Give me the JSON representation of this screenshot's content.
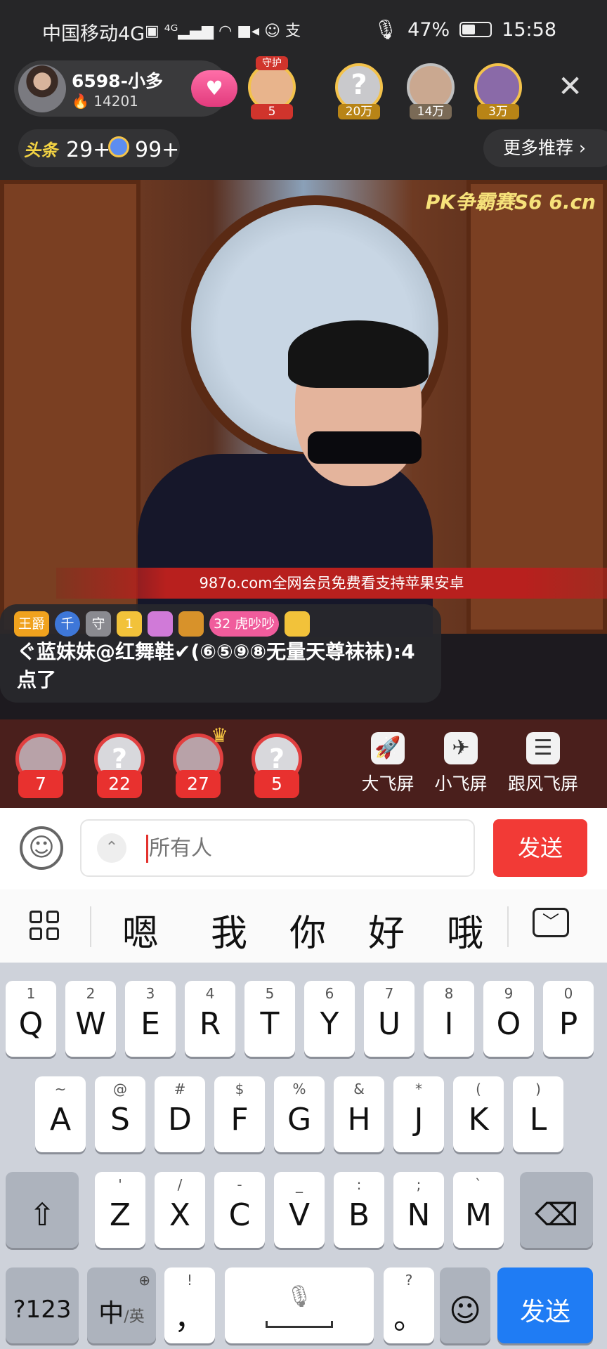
{
  "status_bar": {
    "carrier": "中国移动4G",
    "battery": "47%",
    "time": "15:58",
    "icons": [
      "hd-icon",
      "signal-icon",
      "wifi-icon",
      "video-icon",
      "wechat-icon",
      "alipay-icon",
      "mic-icon",
      "battery-icon"
    ]
  },
  "anchor": {
    "name": "6598-小多",
    "heat": "14201",
    "follow_icon": "heart-icon"
  },
  "top_ranks": [
    {
      "label": "5",
      "badge": "守护"
    },
    {
      "label": "20万"
    },
    {
      "label": "14万"
    },
    {
      "label": "3万"
    }
  ],
  "row2": {
    "toutiao_label": "头条",
    "toutiao_count": "29+",
    "star_count": "99+",
    "more_label": "更多推荐 ›"
  },
  "video": {
    "logo": "PK争霸赛S6 6.cn",
    "banner": "987o.com全网会员免费看支持苹果安卓"
  },
  "chat": {
    "badges": [
      "王爵",
      "千",
      "守",
      "1",
      "",
      "",
      "32 虎吵吵",
      ""
    ],
    "message": "ぐ蓝妹妹@红舞鞋✔(⑥⑤⑨⑧无量天尊袜袜):4点了"
  },
  "gifts": [
    {
      "count": "7"
    },
    {
      "count": "22"
    },
    {
      "count": "27"
    },
    {
      "count": "5"
    }
  ],
  "fly_buttons": [
    {
      "label": "大飞屏",
      "icon": "rocket-icon"
    },
    {
      "label": "小飞屏",
      "icon": "rocket-small-icon"
    },
    {
      "label": "跟风飞屏",
      "icon": "doc-icon"
    }
  ],
  "input": {
    "placeholder": "所有人",
    "send_label": "发送"
  },
  "suggestions": [
    "嗯",
    "我",
    "你",
    "好",
    "哦"
  ],
  "keyboard": {
    "row1": [
      [
        "1",
        "Q"
      ],
      [
        "2",
        "W"
      ],
      [
        "3",
        "E"
      ],
      [
        "4",
        "R"
      ],
      [
        "5",
        "T"
      ],
      [
        "6",
        "Y"
      ],
      [
        "7",
        "U"
      ],
      [
        "8",
        "I"
      ],
      [
        "9",
        "O"
      ],
      [
        "0",
        "P"
      ]
    ],
    "row2": [
      [
        "~",
        "A"
      ],
      [
        "@",
        "S"
      ],
      [
        "#",
        "D"
      ],
      [
        "$",
        "F"
      ],
      [
        "%",
        "G"
      ],
      [
        "&",
        "H"
      ],
      [
        "*",
        "J"
      ],
      [
        "(",
        "K"
      ],
      [
        ")",
        "L"
      ]
    ],
    "row3": [
      [
        "'",
        "Z"
      ],
      [
        "/",
        "X"
      ],
      [
        "-",
        "C"
      ],
      [
        "_",
        "V"
      ],
      [
        ":",
        "B"
      ],
      [
        ";",
        "N"
      ],
      [
        "`",
        "M"
      ]
    ],
    "num_label": "?123",
    "lang_label": "中",
    "lang_sub": "/英",
    "comma_hint": "!",
    "comma": "，",
    "period_hint": "?",
    "period": "。",
    "send_label": "发送"
  }
}
